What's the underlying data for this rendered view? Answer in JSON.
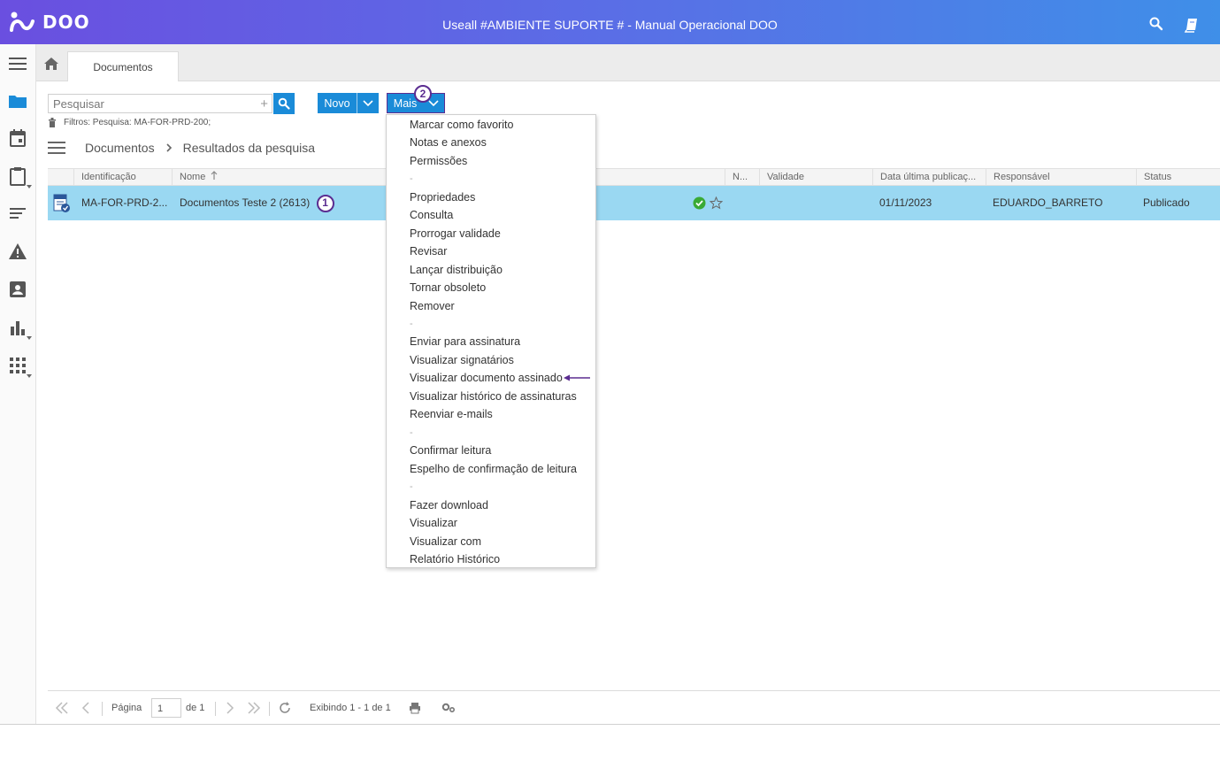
{
  "app": {
    "logo_text": "DOO",
    "title": "Useall #AMBIENTE SUPORTE # - Manual Operacional DOO"
  },
  "tabs": [
    {
      "label": "Documentos"
    }
  ],
  "toolbar": {
    "search_placeholder": "Pesquisar",
    "new_label": "Novo",
    "more_label": "Mais",
    "more_badge": "2",
    "filter_text": "Filtros: Pesquisa: MA-FOR-PRD-200;"
  },
  "breadcrumb": {
    "root": "Documentos",
    "current": "Resultados da pesquisa"
  },
  "grid": {
    "columns": [
      "Identificação",
      "Nome",
      "N...",
      "Validade",
      "Data última publicaç...",
      "Responsável",
      "Status"
    ],
    "rows": [
      {
        "identificacao": "MA-FOR-PRD-2...",
        "nome": "Documentos Teste 2 (2613)",
        "badge": "1",
        "data": "01/11/2023",
        "responsavel": "EDUARDO_BARRETO",
        "status": "Publicado"
      }
    ]
  },
  "menu": {
    "items": [
      "Marcar como favorito",
      "Notas e anexos",
      "Permissões",
      "-",
      "Propriedades",
      "Consulta",
      "Prorrogar validade",
      "Revisar",
      "Lançar distribuição",
      "Tornar obsoleto",
      "Remover",
      "-",
      "Enviar para assinatura",
      "Visualizar signatários",
      "Visualizar documento assinado",
      "Visualizar histórico de assinaturas",
      "Reenviar e-mails",
      "-",
      "Confirmar leitura",
      "Espelho de confirmação de leitura",
      "-",
      "Fazer download",
      "Visualizar",
      "Visualizar com",
      "Relatório Histórico"
    ],
    "highlighted": "Visualizar documento assinado"
  },
  "pager": {
    "page_label": "Página",
    "page_value": "1",
    "of_label": "de 1",
    "showing": "Exibindo 1 - 1 de 1"
  },
  "colors": {
    "accent": "#1a8bd8",
    "row_selected": "#9ad8f2",
    "annotation": "#5b2d91",
    "status_ok": "#3aaa35"
  }
}
